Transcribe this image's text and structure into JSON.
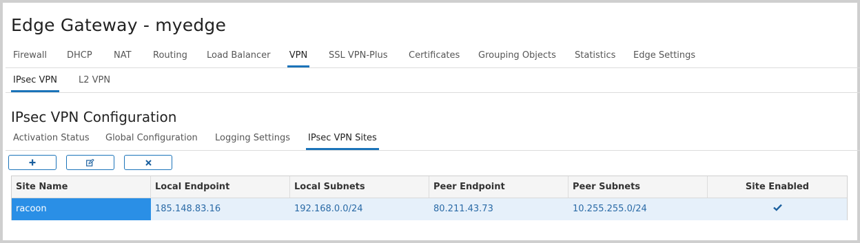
{
  "title": "Edge Gateway - myedge",
  "main_tabs": [
    "Firewall",
    "DHCP",
    "NAT",
    "Routing",
    "Load Balancer",
    "VPN",
    "SSL VPN-Plus",
    "Certificates",
    "Grouping Objects",
    "Statistics",
    "Edge Settings"
  ],
  "main_tab_active": "VPN",
  "sub_tabs": [
    "IPsec VPN",
    "L2 VPN"
  ],
  "sub_tab_active": "IPsec VPN",
  "section_title": "IPsec VPN Configuration",
  "config_tabs": [
    "Activation Status",
    "Global Configuration",
    "Logging Settings",
    "IPsec VPN Sites"
  ],
  "config_tab_active": "IPsec VPN Sites",
  "toolbar": {
    "add_icon": "plus-icon",
    "edit_icon": "edit-icon",
    "delete_icon": "close-icon"
  },
  "table": {
    "columns": [
      "Site Name",
      "Local Endpoint",
      "Local Subnets",
      "Peer Endpoint",
      "Peer Subnets",
      "Site Enabled"
    ],
    "rows": [
      {
        "site_name": "racoon",
        "local_endpoint": "185.148.83.16",
        "local_subnets": "192.168.0.0/24",
        "peer_endpoint": "80.211.43.73",
        "peer_subnets": "10.255.255.0/24",
        "site_enabled": true,
        "site_enabled_icon": "checkmark-icon"
      }
    ]
  },
  "colors": {
    "accent": "#1a73b9",
    "selected_cell": "#2a8fe6",
    "row_highlight": "#e6f0fa",
    "link_text": "#2a6aa6"
  }
}
